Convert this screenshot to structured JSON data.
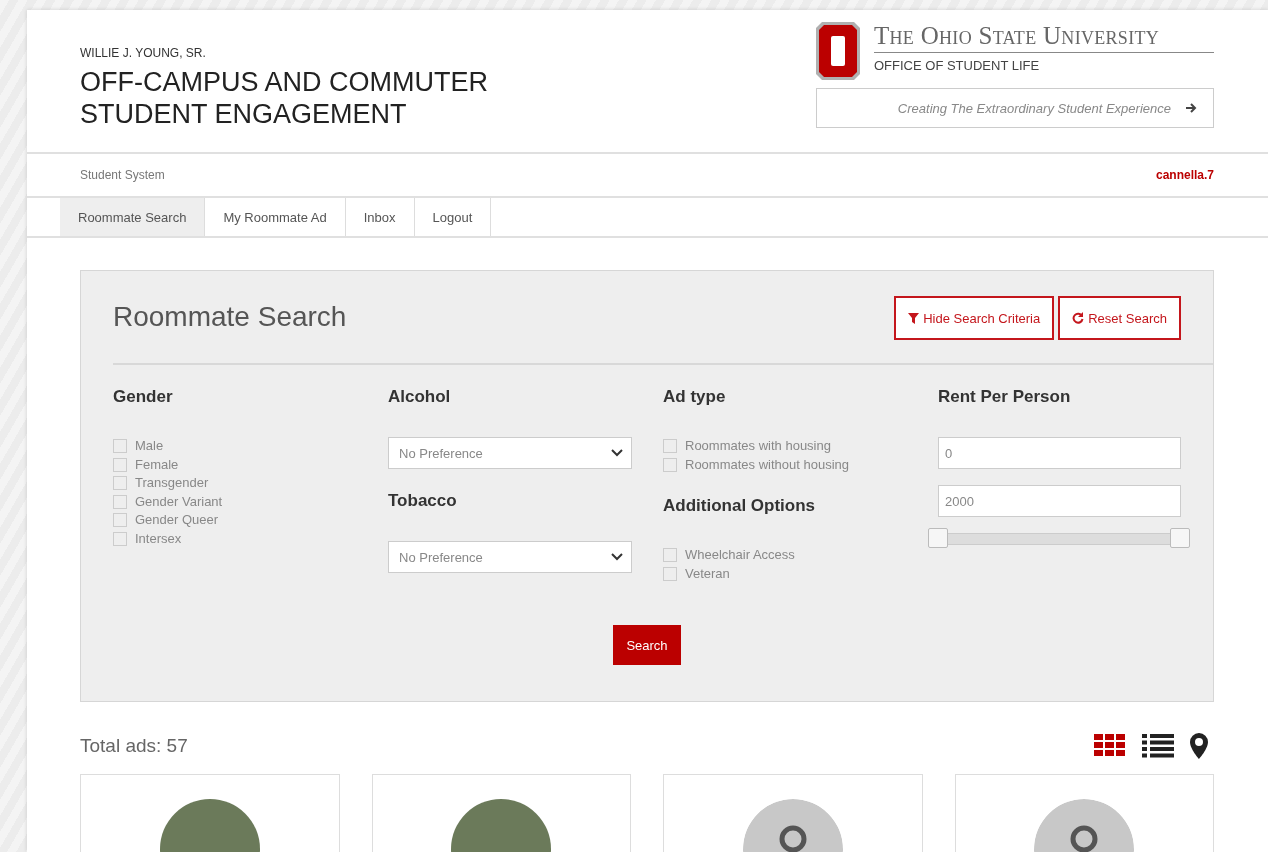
{
  "header": {
    "kicker": "WILLIE J. YOUNG, SR.",
    "title_lines": [
      "OFF-CAMPUS AND COMMUTER",
      "STUDENT ENGAGEMENT"
    ],
    "university": "The Ohio State University",
    "office": "OFFICE OF STUDENT LIFE",
    "tagline": "Creating The Extraordinary Student Experience"
  },
  "system_bar": {
    "label": "Student System",
    "user": "cannella.7"
  },
  "tabs": [
    {
      "label": "Roommate Search",
      "selected": true
    },
    {
      "label": "My Roommate Ad",
      "selected": false
    },
    {
      "label": "Inbox",
      "selected": false
    },
    {
      "label": "Logout",
      "selected": false
    }
  ],
  "search_panel": {
    "title": "Roommate Search",
    "buttons": [
      {
        "label": "Hide Search Criteria",
        "kind": "filter"
      },
      {
        "label": "Reset Search",
        "kind": "reset"
      }
    ],
    "gender": {
      "heading": "Gender",
      "options": [
        {
          "label": "Male",
          "checked": false
        },
        {
          "label": "Female",
          "checked": false
        },
        {
          "label": "Transgender",
          "checked": false
        },
        {
          "label": "Gender Variant",
          "checked": false
        },
        {
          "label": "Gender Queer",
          "checked": false
        },
        {
          "label": "Intersex",
          "checked": false
        }
      ]
    },
    "alcohol": {
      "heading": "Alcohol",
      "value": "No Preference"
    },
    "tobacco": {
      "heading": "Tobacco",
      "value": "No Preference"
    },
    "ad_type": {
      "heading": "Ad type",
      "options": [
        {
          "label": "Roommates with housing",
          "checked": false
        },
        {
          "label": "Roommates without housing",
          "checked": false
        }
      ]
    },
    "additional": {
      "heading": "Additional Options",
      "options": [
        {
          "label": "Wheelchair Access",
          "checked": false
        },
        {
          "label": "Veteran",
          "checked": false
        }
      ]
    },
    "rent": {
      "heading": "Rent Per Person",
      "min": "0",
      "max": "2000",
      "thumbs": [
        {
          "level": 0
        },
        {
          "level": 1
        }
      ]
    },
    "submit": "Search"
  },
  "results": {
    "total": "Total ads: 57",
    "views": [
      {
        "kind": "grid",
        "selected": true
      },
      {
        "kind": "list",
        "selected": false
      },
      {
        "kind": "map",
        "selected": false
      }
    ],
    "cards": [
      {
        "kind": "photo"
      },
      {
        "kind": "photo"
      },
      {
        "kind": "placeholder"
      },
      {
        "kind": "placeholder"
      }
    ]
  }
}
